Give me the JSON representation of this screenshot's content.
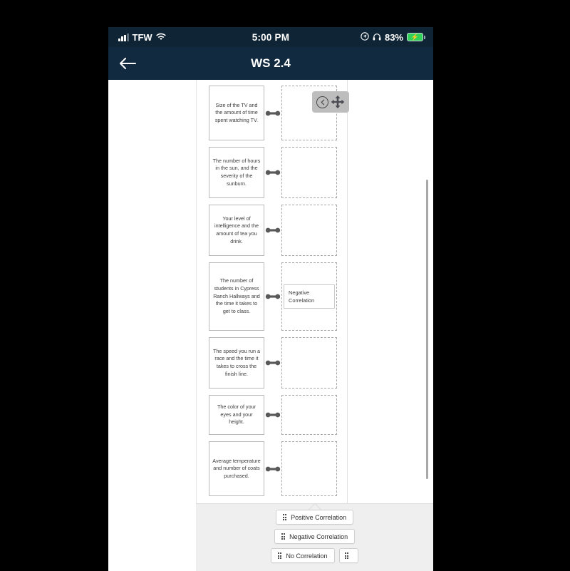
{
  "status_bar": {
    "carrier": "TFW",
    "time": "5:00 PM",
    "battery_percent": "83%",
    "icons": {
      "signal": "signal-bars-icon",
      "wifi": "wifi-icon",
      "location": "location-arrow-icon",
      "headphones": "headphones-icon",
      "battery": "battery-charging-icon"
    }
  },
  "nav_bar": {
    "title": "WS 2.4",
    "back_icon": "back-arrow-icon"
  },
  "move_widget": {
    "collapse_icon": "chevron-left-circle-icon",
    "move_icon": "move-four-arrows-icon"
  },
  "worksheet": {
    "rows": [
      {
        "prompt": "Size of the TV and the amount of time spent watching TV.",
        "answer": ""
      },
      {
        "prompt": "The number of hours in the sun, and the severity of the sunburn.",
        "answer": ""
      },
      {
        "prompt": "Your level of intelligence and the amount of tea you drink.",
        "answer": ""
      },
      {
        "prompt": "The number of students in Cypress Ranch Hallways and the time it takes to get to class.",
        "answer": "Negative Correlation"
      },
      {
        "prompt": "The speed you run a race and the time it takes to cross the finish line.",
        "answer": ""
      },
      {
        "prompt": "The color of your eyes and your height.",
        "answer": ""
      },
      {
        "prompt": "Average temperature and number of coats purchased.",
        "answer": ""
      }
    ]
  },
  "answer_bank": {
    "chips": [
      "Positive Correlation",
      "Negative Correlation",
      "No Correlation"
    ],
    "extra_chip_label": "",
    "grip_icon": "drag-handle-icon",
    "notch_icon": "collapse-chevron-up-icon"
  }
}
